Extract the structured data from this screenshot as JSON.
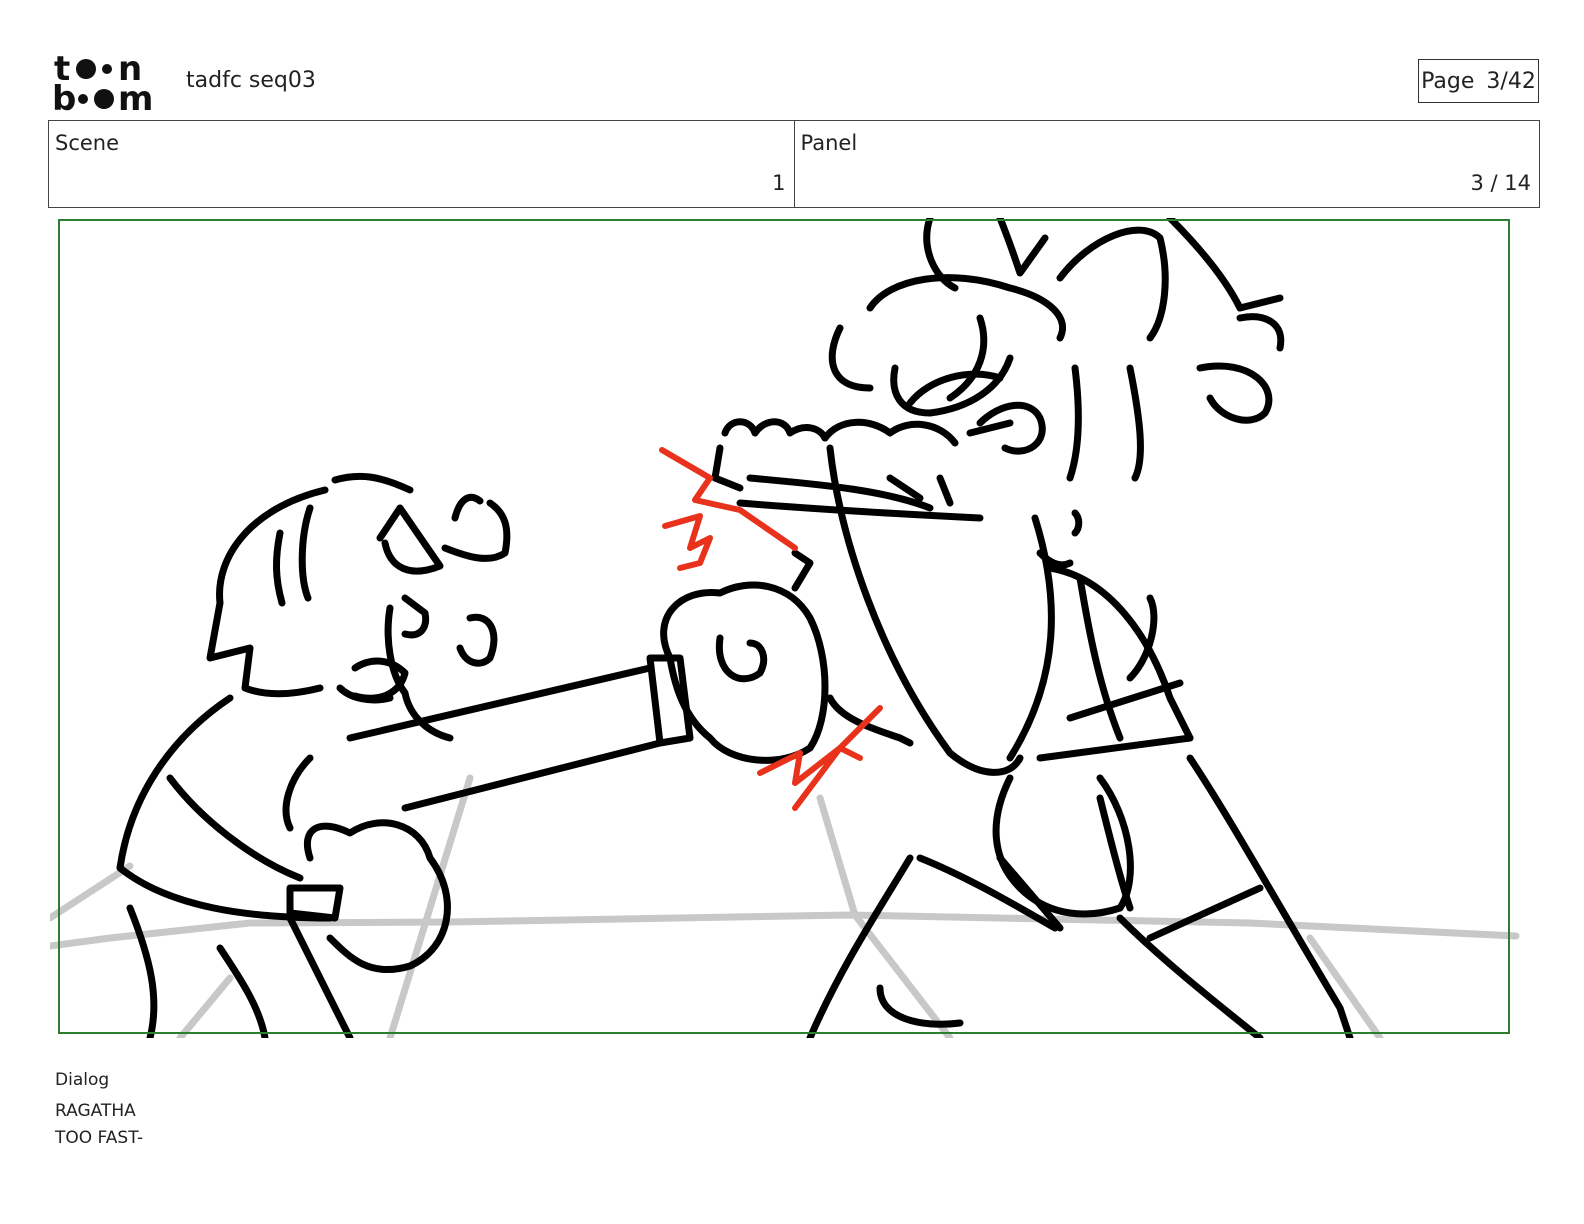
{
  "header": {
    "logo_text": "toon boom",
    "project_title": "tadfc seq03",
    "page_label": "Page",
    "page_value": "3/42"
  },
  "info": {
    "scene_label": "Scene",
    "scene_value": "1",
    "panel_label": "Panel",
    "panel_value": "3 / 14"
  },
  "panel": {
    "frame_color": "#2e7d32",
    "sketch_color": "#000000",
    "impact_color": "#e8321c",
    "ring_color": "#c8c8c8"
  },
  "dialog": {
    "label": "Dialog",
    "speaker": "RAGATHA",
    "line": "TOO FAST-"
  }
}
